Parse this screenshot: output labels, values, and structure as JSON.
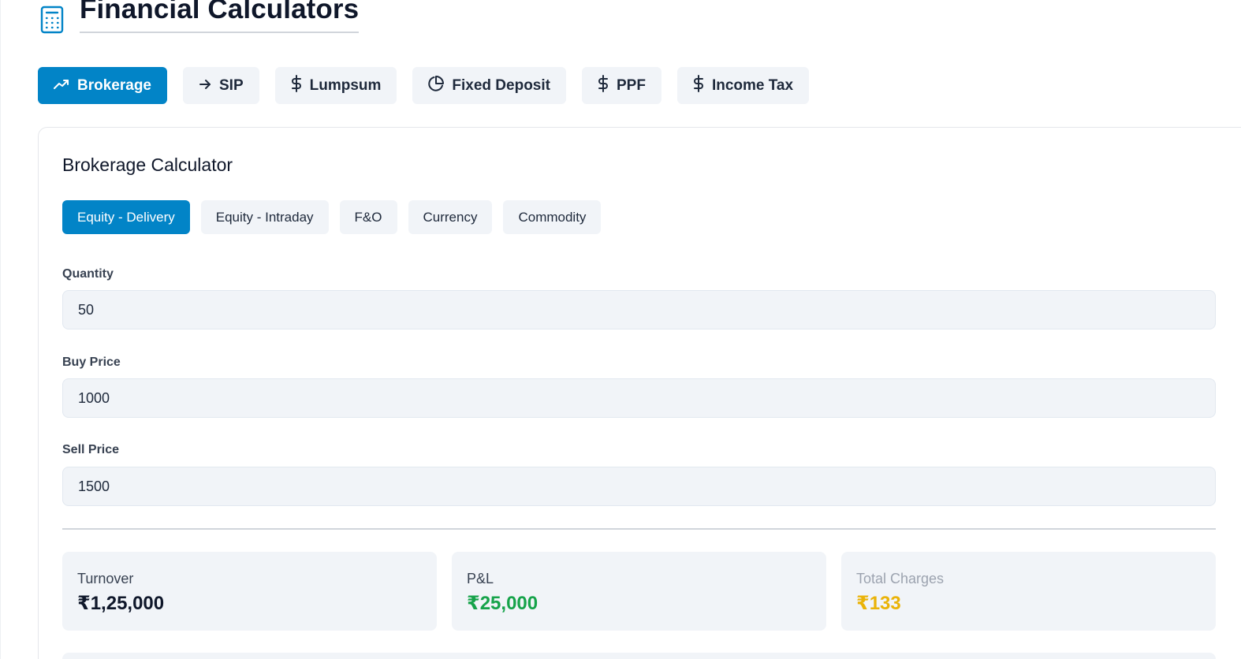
{
  "header": {
    "title": "Financial Calculators",
    "icon": "calculator-icon"
  },
  "colors": {
    "accent": "#0284c7",
    "profit": "#16a34a",
    "charges": "#eab308"
  },
  "tabs": [
    {
      "label": "Brokerage",
      "icon": "trending-up-icon",
      "active": true
    },
    {
      "label": "SIP",
      "icon": "arrow-right-icon",
      "active": false
    },
    {
      "label": "Lumpsum",
      "icon": "dollar-icon",
      "active": false
    },
    {
      "label": "Fixed Deposit",
      "icon": "pie-chart-icon",
      "active": false
    },
    {
      "label": "PPF",
      "icon": "dollar-icon",
      "active": false
    },
    {
      "label": "Income Tax",
      "icon": "dollar-icon",
      "active": false
    }
  ],
  "calculator": {
    "title": "Brokerage Calculator",
    "segments": [
      {
        "label": "Equity - Delivery",
        "active": true
      },
      {
        "label": "Equity - Intraday",
        "active": false
      },
      {
        "label": "F&O",
        "active": false
      },
      {
        "label": "Currency",
        "active": false
      },
      {
        "label": "Commodity",
        "active": false
      }
    ],
    "fields": {
      "quantity": {
        "label": "Quantity",
        "value": "50"
      },
      "buy_price": {
        "label": "Buy Price",
        "value": "1000"
      },
      "sell_price": {
        "label": "Sell Price",
        "value": "1500"
      }
    },
    "results": {
      "turnover": {
        "label": "Turnover",
        "value": "₹1,25,000"
      },
      "pnl": {
        "label": "P&L",
        "value": "₹25,000"
      },
      "total_charges": {
        "label": "Total Charges",
        "value": "₹133"
      }
    }
  }
}
